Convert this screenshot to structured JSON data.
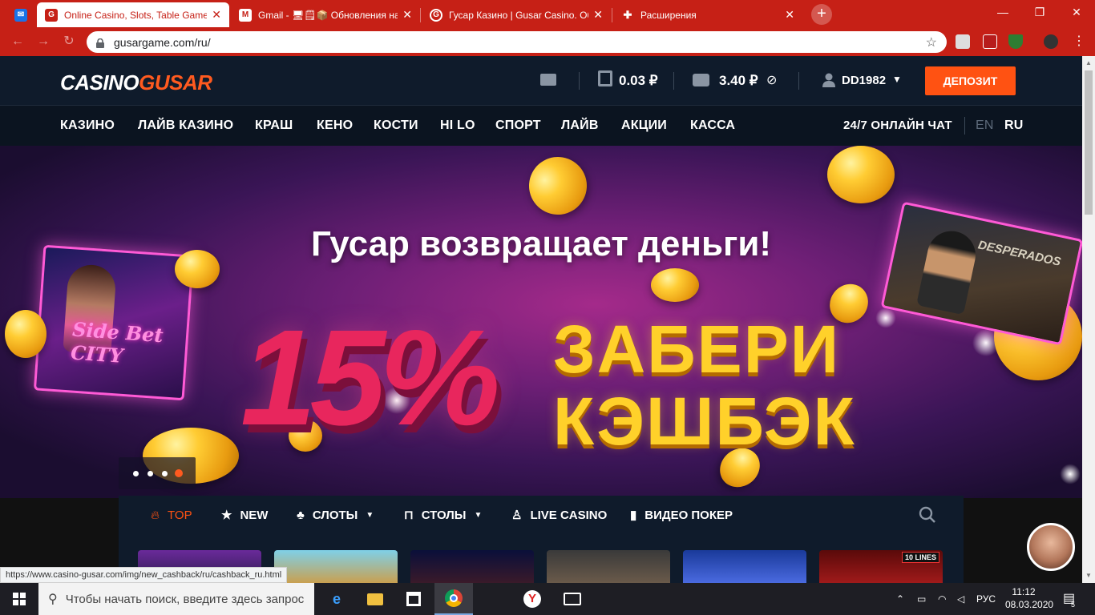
{
  "browser": {
    "tabs": [
      {
        "title": "",
        "icon": "mail-icon",
        "active": false
      },
      {
        "title": "Online Casino, Slots, Table Game",
        "icon": "casino-tab-icon",
        "active": true
      },
      {
        "title": "Gmail - 🖥🗒📦 Обновления на",
        "icon": "gmail-icon",
        "active": false
      },
      {
        "title": "Гусар Казино | Gusar Casino. Об",
        "icon": "casino-tab-icon",
        "active": false
      },
      {
        "title": "Расширения",
        "icon": "puzzle-icon",
        "active": false
      }
    ],
    "new_tab": "+",
    "url": "gusargame.com/ru/",
    "status_url": "https://www.casino-gusar.com/img/new_cashback/ru/cashback_ru.html"
  },
  "site": {
    "logo_part1": "CASINO",
    "logo_part2": "GUSAR",
    "bonus_balance": "0.03 ₽",
    "balance": "3.40 ₽",
    "username": "DD1982",
    "deposit_label": "ДЕПОЗИТ",
    "nav": [
      "КАЗИНО",
      "ЛАЙВ КАЗИНО",
      "КРАШ",
      "КЕНО",
      "КОСТИ",
      "HI LO",
      "СПОРТ",
      "ЛАЙВ",
      "АКЦИИ",
      "КАССА"
    ],
    "live_chat": "24/7 ОНЛАЙН ЧАТ",
    "lang_en": "EN",
    "lang_ru": "RU"
  },
  "banner": {
    "title": "Гусар возвращает деньги!",
    "percent": "15%",
    "line1": "ЗАБЕРИ",
    "line2": "КЭШБЭК",
    "card_left_text": "Side Bet CITY",
    "card_right_text": "DESPERADOS",
    "slides": 4,
    "active_slide": 4
  },
  "categories": [
    {
      "label": "TOP",
      "icon": "fire-icon",
      "active": true
    },
    {
      "label": "NEW",
      "icon": "star-icon",
      "active": false
    },
    {
      "label": "СЛОТЫ",
      "icon": "cherry-icon",
      "active": false,
      "dropdown": true
    },
    {
      "label": "СТОЛЫ",
      "icon": "table-icon",
      "active": false,
      "dropdown": true
    },
    {
      "label": "LIVE CASINO",
      "icon": "dealer-icon",
      "active": false
    },
    {
      "label": "ВИДЕО ПОКЕР",
      "icon": "cards-icon",
      "active": false
    }
  ],
  "game_badge": "10 LINES",
  "taskbar": {
    "search_placeholder": "Чтобы начать поиск, введите здесь запрос",
    "lang": "РУС",
    "time": "11:12",
    "date": "08.03.2020",
    "notifications": "5"
  },
  "colors": {
    "browser_red": "#c62016",
    "site_dark": "#0f1b2b",
    "accent_orange": "#ff5212",
    "gold": "#ffd12a",
    "pink": "#e8265d"
  }
}
